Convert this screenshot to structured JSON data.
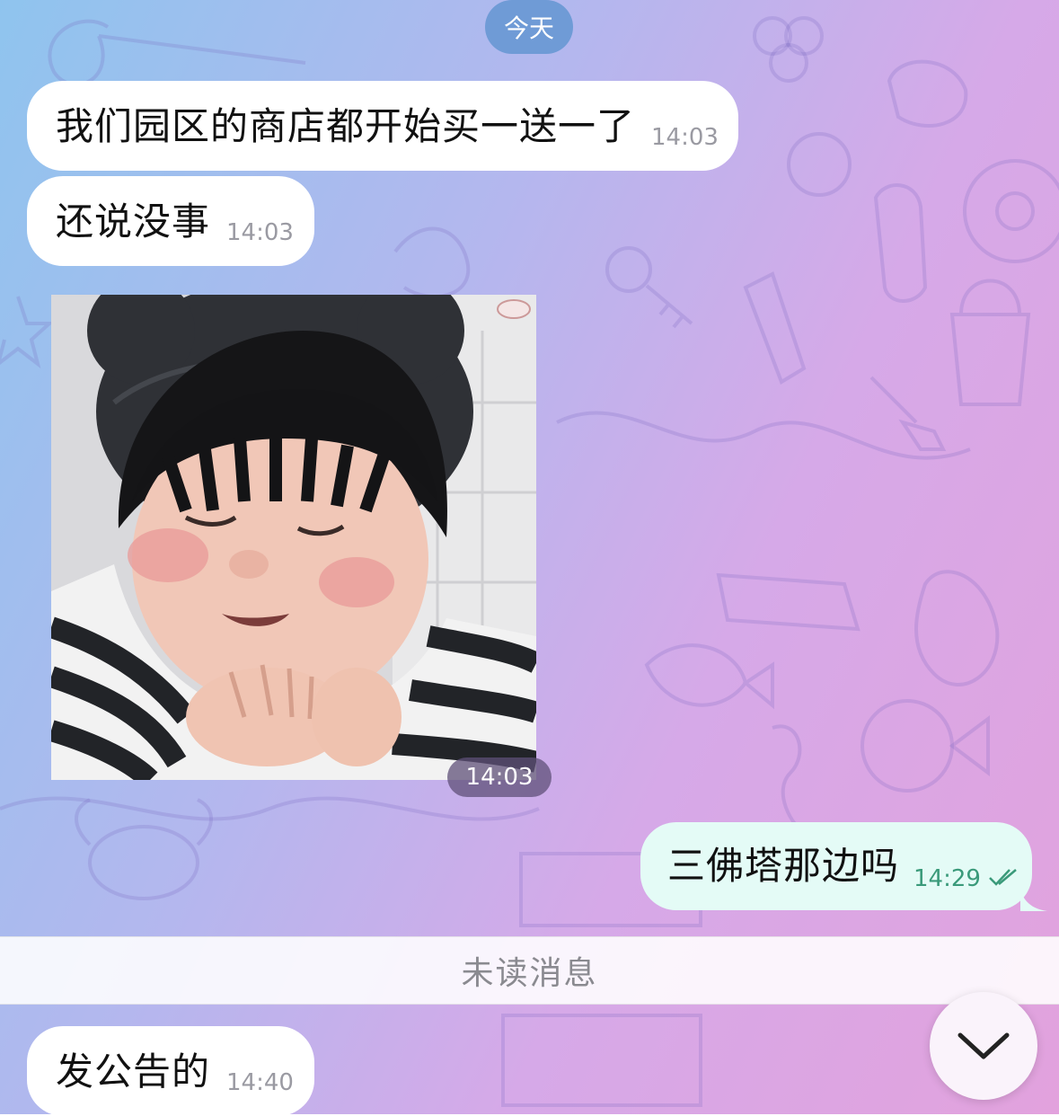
{
  "chat": {
    "date_label": "今天",
    "unread_label": "未读消息",
    "messages": [
      {
        "text": "我们园区的商店都开始买一送一了",
        "time": "14:03",
        "direction": "incoming"
      },
      {
        "text": "还说没事",
        "time": "14:03",
        "direction": "incoming"
      },
      {
        "media": "photo",
        "time": "14:03",
        "direction": "incoming"
      },
      {
        "text": "三佛塔那边吗",
        "time": "14:29",
        "direction": "outgoing",
        "status": "read"
      },
      {
        "text": "发公告的",
        "time": "14:40",
        "direction": "incoming"
      }
    ]
  },
  "icons": {
    "read_status": "double-check-icon",
    "scroll_down": "chevron-down-icon"
  },
  "colors": {
    "outgoing_bubble": "#e4fbf6",
    "incoming_bubble": "#ffffff",
    "date_pill": "#6f9bd6",
    "outgoing_time": "#3a9a7a"
  }
}
